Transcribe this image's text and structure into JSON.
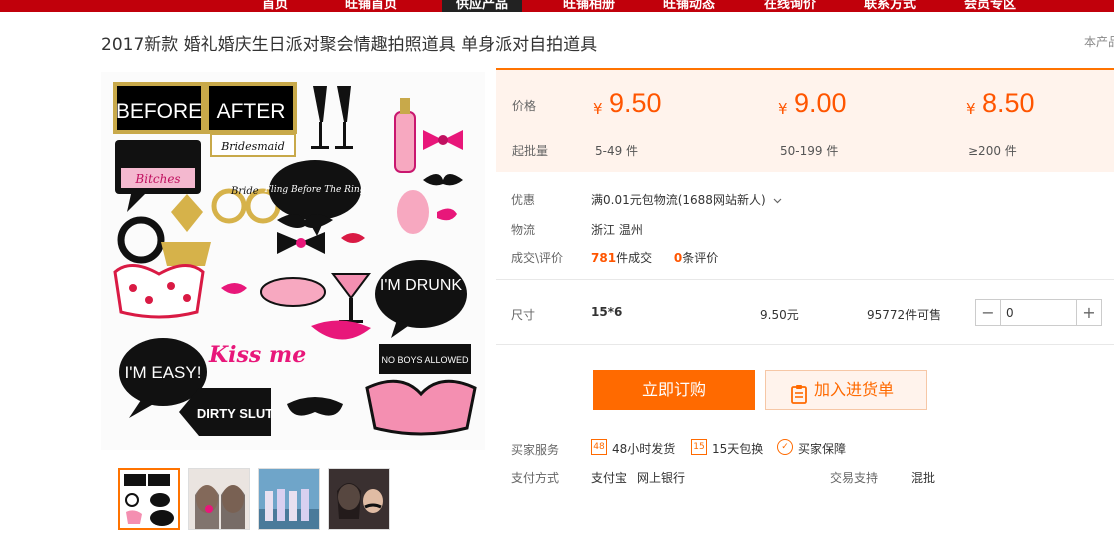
{
  "nav": {
    "items": [
      "首页",
      "旺铺首页",
      "供应产品",
      "旺铺相册",
      "旺铺动态",
      "在线询价",
      "联系方式",
      "会员专区"
    ],
    "active_index": 2
  },
  "product": {
    "title": "2017新款 婚礼婚庆生日派对聚会情趣拍照道具 单身派对自拍道具",
    "title_right": "本产品"
  },
  "gallery": {
    "props": [
      "BEFORE",
      "AFTER",
      "Bridesmaid",
      "Bitches",
      "Bride",
      "Fling Before The Ring",
      "I'M DRUNK",
      "Kiss me",
      "I'M EASY!",
      "DIRTY SLUT",
      "NO BOYS ALLOWED"
    ],
    "thumb_count": 4
  },
  "price": {
    "price_label": "价格",
    "batch_label": "起批量",
    "currency": "¥",
    "tiers": [
      {
        "value": "9.50",
        "range": "5-49 件"
      },
      {
        "value": "9.00",
        "range": "50-199 件"
      },
      {
        "value": "8.50",
        "range": "≥200 件"
      }
    ]
  },
  "info": {
    "promo_label": "优惠",
    "promo_value": "满0.01元包物流(1688网站新人)",
    "logistics_label": "物流",
    "logistics_value": "浙江 温州",
    "deal_label": "成交\\评价",
    "deal_count": "781",
    "deal_suffix": "件成交",
    "review_count": "0",
    "review_suffix": "条评价"
  },
  "sku": {
    "size_label": "尺寸",
    "size_value": "15*6",
    "price": "9.50元",
    "stock": "95772件可售",
    "quantity": "0"
  },
  "actions": {
    "order_label": "立即订购",
    "cart_label": "加入进货单"
  },
  "service": {
    "label": "买家服务",
    "items": [
      "48小时发货",
      "15天包换",
      "买家保障"
    ],
    "payment_label": "支付方式",
    "payment_methods": [
      "支付宝",
      "网上银行"
    ],
    "trade_label": "交易支持",
    "trade_value": "混批"
  },
  "colors": {
    "accent": "#ff6a00",
    "nav_bg": "#c1000b",
    "price_bg": "#fff3ec"
  }
}
